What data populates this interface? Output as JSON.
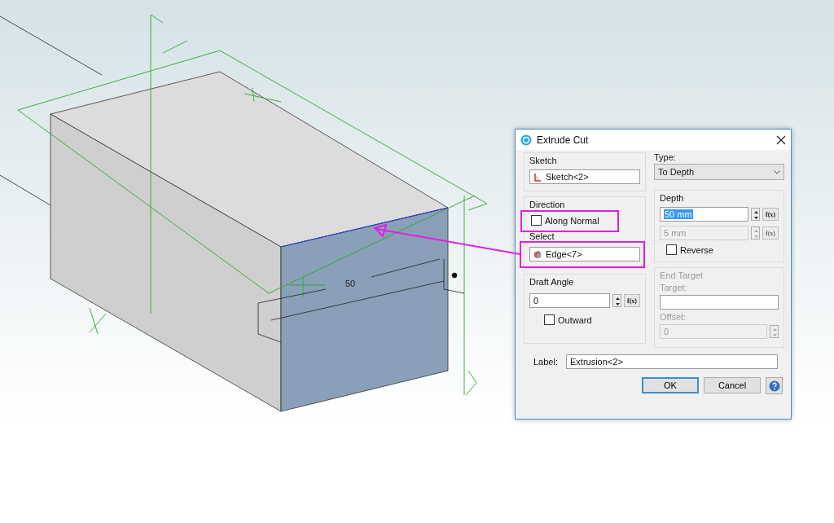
{
  "viewport": {
    "dimension": "50"
  },
  "dialog": {
    "title": "Extrude Cut",
    "sketch": {
      "heading": "Sketch",
      "value": "Sketch<2>"
    },
    "direction": {
      "heading": "Direction",
      "along_normal": {
        "label": "Along Normal",
        "checked": false
      },
      "select_label": "Select",
      "select_value": "Edge<7>"
    },
    "draft_angle": {
      "heading": "Draft Angle",
      "value": "0",
      "fx_label": "f(x)",
      "outward": {
        "label": "Outward",
        "checked": false
      }
    },
    "type": {
      "label": "Type:",
      "value": "To Depth"
    },
    "depth": {
      "heading": "Depth",
      "fields": [
        {
          "value": "50 mm",
          "fx_label": "f(x)",
          "disabled": false,
          "highlighted": true
        },
        {
          "value": "5 mm",
          "fx_label": "f(x)",
          "disabled": true,
          "highlighted": false
        }
      ],
      "reverse": {
        "label": "Reverse",
        "checked": false
      }
    },
    "end_target": {
      "heading": "End Target",
      "disabled": true,
      "target_label": "Target:",
      "offset_label": "Offset:",
      "offset_value": "0"
    },
    "label_field": {
      "label": "Label:",
      "value": "Extrusion<2>"
    },
    "buttons": [
      {
        "label": "OK",
        "kind": "default"
      },
      {
        "label": "Cancel",
        "kind": "normal"
      }
    ]
  }
}
